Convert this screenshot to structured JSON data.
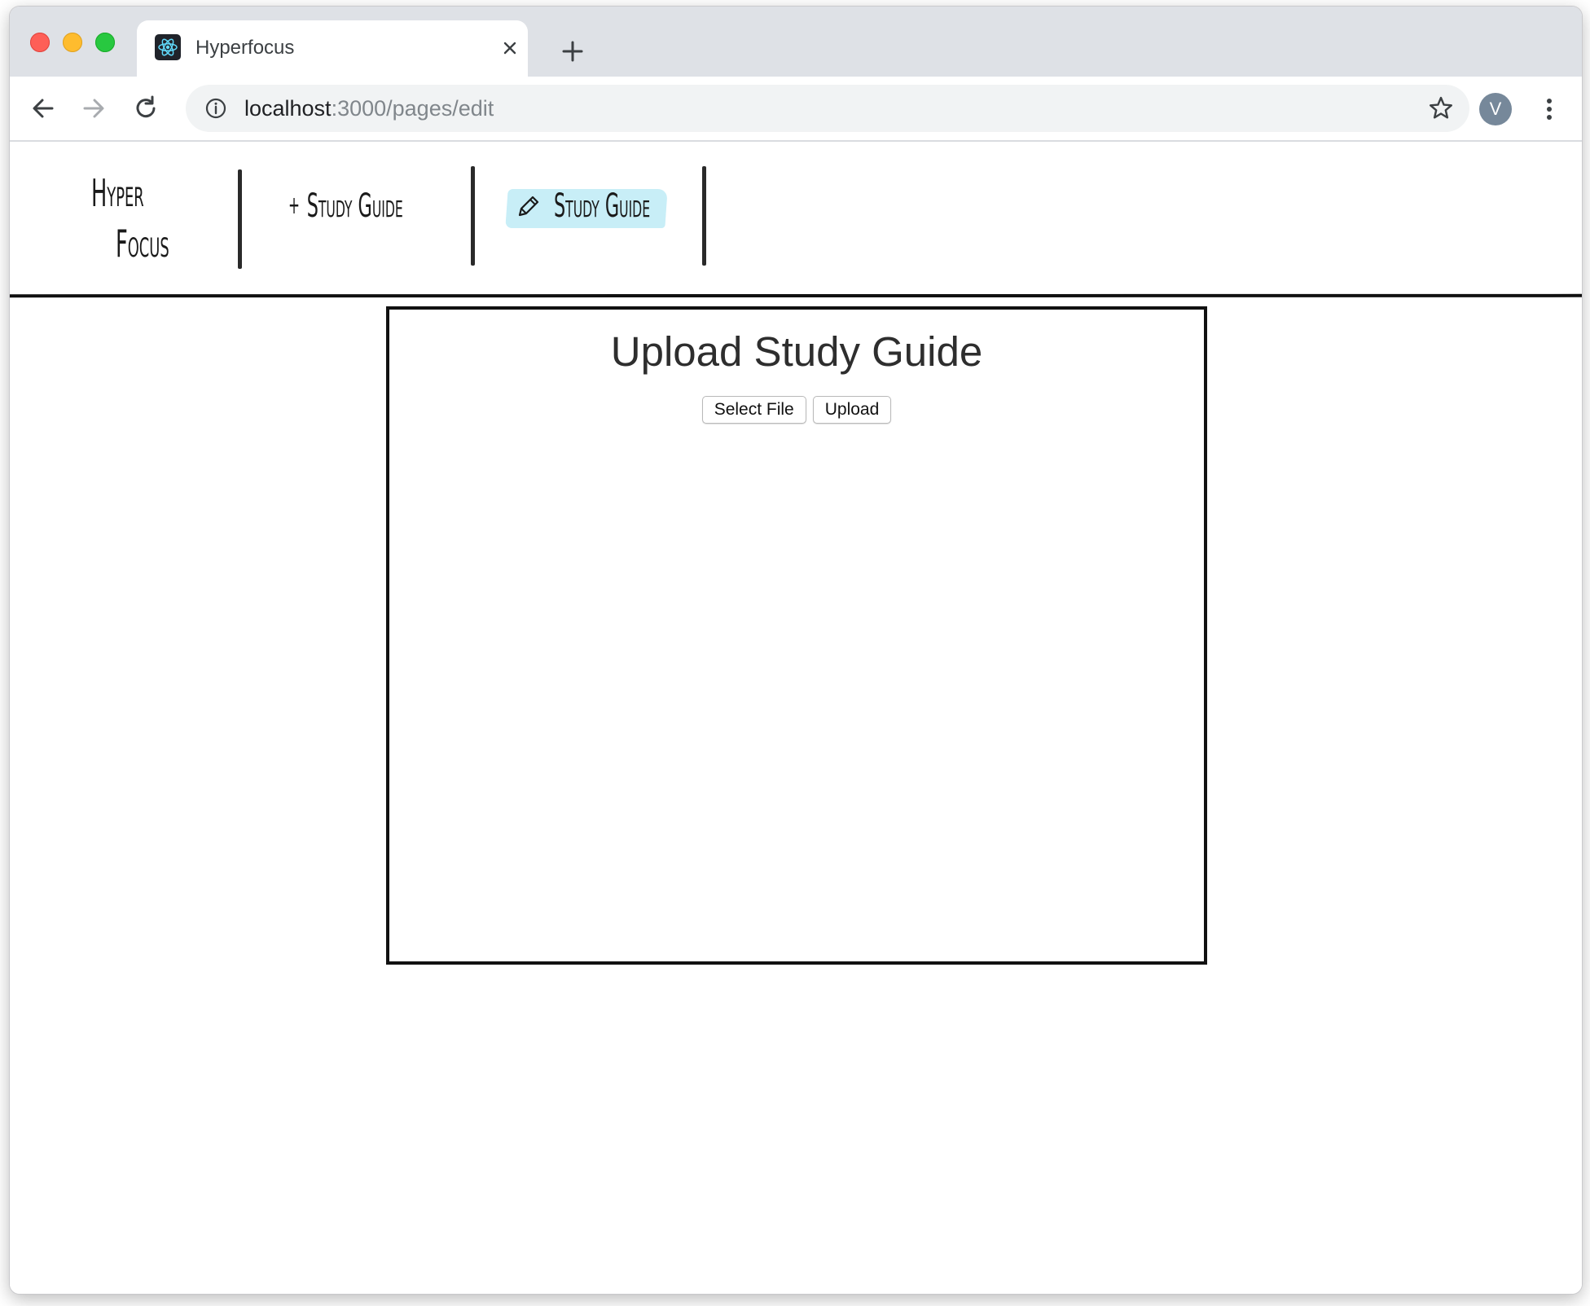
{
  "browser": {
    "tab": {
      "title": "Hyperfocus",
      "favicon": "react-logo-icon"
    },
    "address_bar": {
      "host": "localhost",
      "path": ":3000/pages/edit"
    },
    "profile_initial": "V"
  },
  "app": {
    "brand": {
      "line1": "Hyper",
      "line2": "Focus"
    },
    "nav": {
      "new_study_guide": {
        "prefix": "+",
        "label": "Study Guide",
        "icon": "plus-icon"
      },
      "edit_study_guide": {
        "label": "Study Guide",
        "icon": "pencil-icon",
        "active": true
      }
    },
    "colors": {
      "active_highlight": "#c8eef7",
      "ink": "#1a1a1a"
    }
  },
  "upload_panel": {
    "title": "Upload Study Guide",
    "select_file_label": "Select File",
    "upload_label": "Upload"
  }
}
